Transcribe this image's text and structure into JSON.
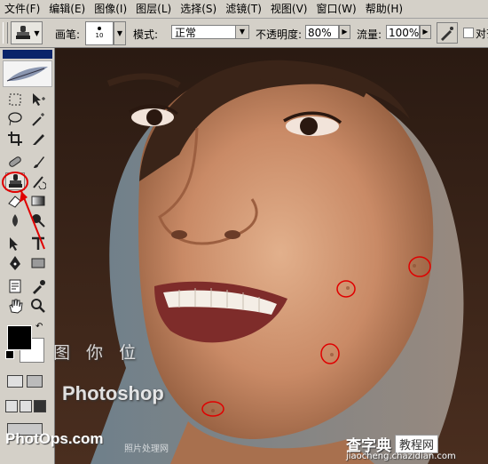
{
  "menu": {
    "items": [
      "文件(F)",
      "编辑(E)",
      "图像(I)",
      "图层(L)",
      "选择(S)",
      "滤镜(T)",
      "视图(V)",
      "窗口(W)",
      "帮助(H)"
    ]
  },
  "options": {
    "brush_label": "画笔:",
    "brush_size": "10",
    "mode_label": "模式:",
    "mode_value": "正常",
    "opacity_label": "不透明度:",
    "opacity_value": "80%",
    "flow_label": "流量:",
    "flow_value": "100%",
    "aligned_label": "对齐"
  },
  "watermarks": {
    "cn": "图 你 位",
    "photoshop": "Photoshop",
    "photops": "PhotOps.com",
    "small": "照片处理网"
  },
  "brand": {
    "name": "查字典",
    "tag": "教程网",
    "url": "jiaocheng.chazidian.com"
  },
  "colors": {
    "ui_gray": "#d4d0c8",
    "highlight_red": "#e00000"
  }
}
